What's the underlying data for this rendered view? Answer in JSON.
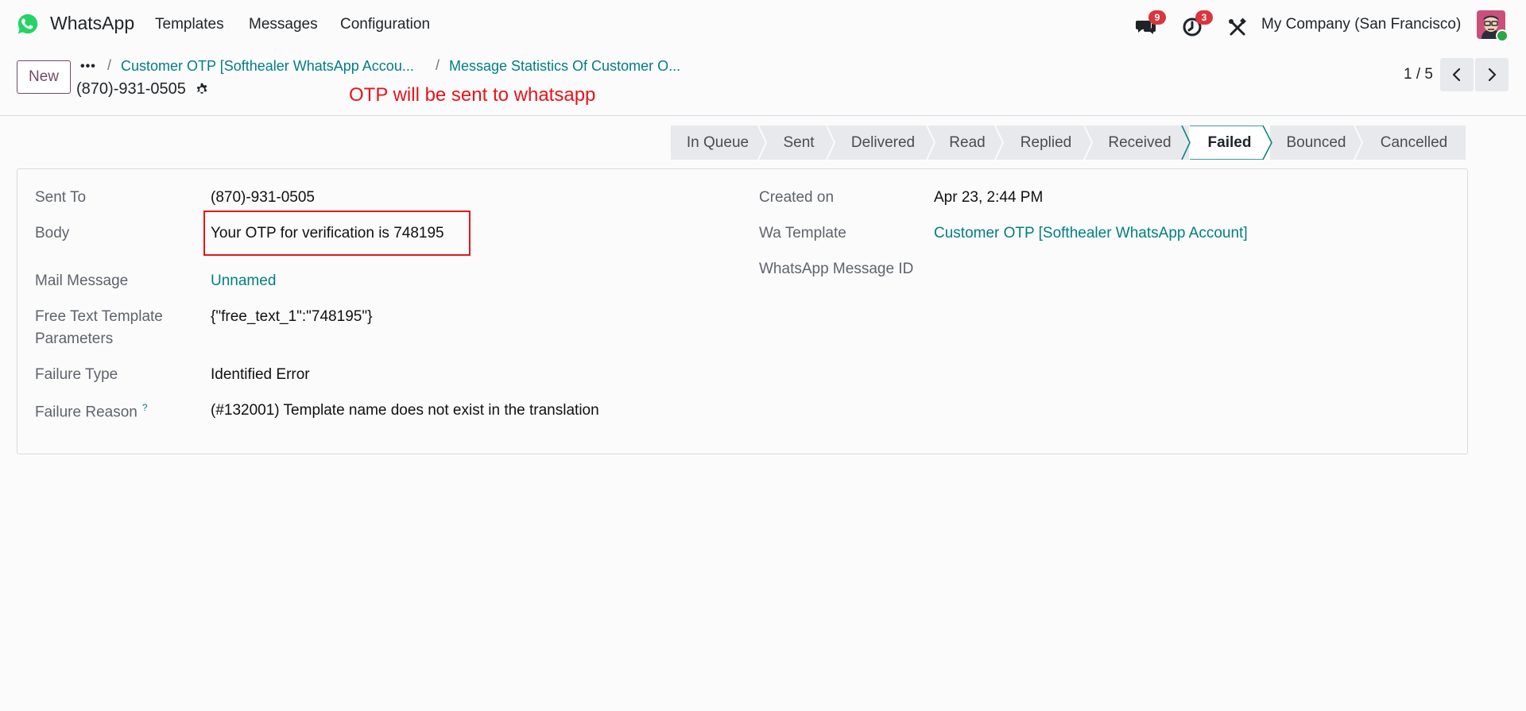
{
  "navbar": {
    "app_name": "WhatsApp",
    "menu": [
      "Templates",
      "Messages",
      "Configuration"
    ],
    "chat_badge": "9",
    "activity_badge": "3",
    "company": "My Company (San Francisco)",
    "logo_color": "#25d366"
  },
  "control_panel": {
    "new_label": "New",
    "more_label": "•••",
    "breadcrumbs": [
      "Customer OTP [Softhealer WhatsApp Accou...",
      "Message Statistics Of Customer O..."
    ],
    "record_title": "(870)-931-0505",
    "annotation": "OTP will be sent to whatsapp",
    "pager": "1 / 5"
  },
  "statusbar": {
    "stages": [
      "In Queue",
      "Sent",
      "Delivered",
      "Read",
      "Replied",
      "Received",
      "Failed",
      "Bounced",
      "Cancelled"
    ],
    "active_stage": "Failed"
  },
  "form": {
    "sent_to_label": "Sent To",
    "sent_to_value": "(870)-931-0505",
    "body_label": "Body",
    "body_value": "Your OTP for verification is 748195",
    "mail_message_label": "Mail Message",
    "mail_message_value": "Unnamed",
    "free_text_label_1": "Free Text Template",
    "free_text_label_2": "Parameters",
    "free_text_value": "{\"free_text_1\":\"748195\"}",
    "failure_type_label": "Failure Type",
    "failure_type_value": "Identified Error",
    "failure_reason_label": "Failure Reason",
    "failure_reason_help": "?",
    "failure_reason_value": "(#132001) Template name does not exist in the translation",
    "created_on_label": "Created on",
    "created_on_value": "Apr 23, 2:44 PM",
    "wa_template_label": "Wa Template",
    "wa_template_value": "Customer OTP [Softhealer WhatsApp Account]",
    "wa_message_id_label": "WhatsApp Message ID"
  }
}
